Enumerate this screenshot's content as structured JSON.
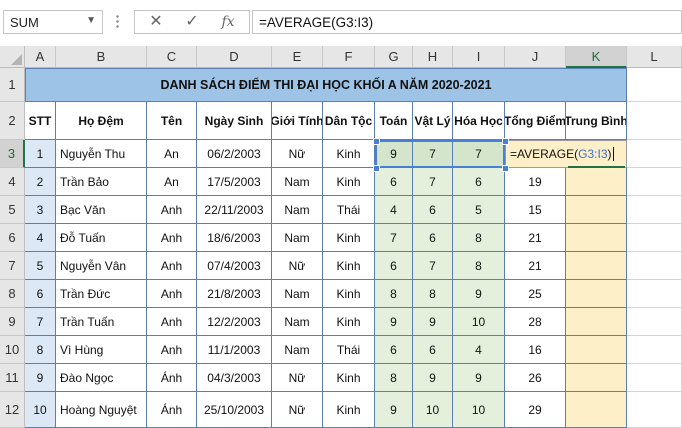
{
  "name_box": "SUM",
  "formula_buttons": {
    "cancel": "✕",
    "enter": "✓",
    "fx": "fx"
  },
  "formula": "=AVERAGE(G3:I3)",
  "columns": [
    "A",
    "B",
    "C",
    "D",
    "E",
    "F",
    "G",
    "H",
    "I",
    "J",
    "K",
    "L"
  ],
  "rows": [
    "1",
    "2",
    "3",
    "4",
    "5",
    "6",
    "7",
    "8",
    "9",
    "10",
    "11",
    "12"
  ],
  "title": "DANH SÁCH ĐIỂM THI ĐẠI HỌC KHỐI A NĂM 2020-2021",
  "headers": [
    "STT",
    "Họ Đệm",
    "Tên",
    "Ngày Sinh",
    "Giới Tính",
    "Dân Tộc",
    "Toán",
    "Vật Lý",
    "Hóa Học",
    "Tổng Điểm",
    "Trung Bình"
  ],
  "students": [
    {
      "stt": "1",
      "ho_dem": "Nguyễn Thu",
      "ten": "An",
      "ngay_sinh": "06/2/2003",
      "gioi_tinh": "Nữ",
      "dan_toc": "Kinh",
      "toan": "9",
      "vat_ly": "7",
      "hoa_hoc": "7",
      "tong_diem": ""
    },
    {
      "stt": "2",
      "ho_dem": "Trần Bảo",
      "ten": "An",
      "ngay_sinh": "17/5/2003",
      "gioi_tinh": "Nam",
      "dan_toc": "Kinh",
      "toan": "6",
      "vat_ly": "7",
      "hoa_hoc": "6",
      "tong_diem": "19"
    },
    {
      "stt": "3",
      "ho_dem": "Bạc Văn",
      "ten": "Anh",
      "ngay_sinh": "22/11/2003",
      "gioi_tinh": "Nam",
      "dan_toc": "Thái",
      "toan": "4",
      "vat_ly": "6",
      "hoa_hoc": "5",
      "tong_diem": "15"
    },
    {
      "stt": "4",
      "ho_dem": "Đỗ Tuấn",
      "ten": "Anh",
      "ngay_sinh": "18/6/2003",
      "gioi_tinh": "Nam",
      "dan_toc": "Kinh",
      "toan": "7",
      "vat_ly": "6",
      "hoa_hoc": "8",
      "tong_diem": "21"
    },
    {
      "stt": "5",
      "ho_dem": "Nguyễn Vân",
      "ten": "Anh",
      "ngay_sinh": "07/4/2003",
      "gioi_tinh": "Nữ",
      "dan_toc": "Kinh",
      "toan": "6",
      "vat_ly": "7",
      "hoa_hoc": "8",
      "tong_diem": "21"
    },
    {
      "stt": "6",
      "ho_dem": "Trần Đức",
      "ten": "Anh",
      "ngay_sinh": "21/8/2003",
      "gioi_tinh": "Nam",
      "dan_toc": "Kinh",
      "toan": "8",
      "vat_ly": "8",
      "hoa_hoc": "9",
      "tong_diem": "25"
    },
    {
      "stt": "7",
      "ho_dem": "Trần Tuấn",
      "ten": "Anh",
      "ngay_sinh": "12/2/2003",
      "gioi_tinh": "Nam",
      "dan_toc": "Kinh",
      "toan": "9",
      "vat_ly": "9",
      "hoa_hoc": "10",
      "tong_diem": "28"
    },
    {
      "stt": "8",
      "ho_dem": "Vì Hùng",
      "ten": "Anh",
      "ngay_sinh": "11/1/2003",
      "gioi_tinh": "Nam",
      "dan_toc": "Thái",
      "toan": "6",
      "vat_ly": "6",
      "hoa_hoc": "4",
      "tong_diem": "16"
    },
    {
      "stt": "9",
      "ho_dem": "Đào Ngọc",
      "ten": "Ánh",
      "ngay_sinh": "04/3/2003",
      "gioi_tinh": "Nữ",
      "dan_toc": "Kinh",
      "toan": "8",
      "vat_ly": "9",
      "hoa_hoc": "9",
      "tong_diem": "26"
    },
    {
      "stt": "10",
      "ho_dem": "Hoàng Nguyệt",
      "ten": "Ánh",
      "ngay_sinh": "25/10/2003",
      "gioi_tinh": "Nữ",
      "dan_toc": "Kinh",
      "toan": "9",
      "vat_ly": "10",
      "hoa_hoc": "10",
      "tong_diem": "29"
    }
  ],
  "editing": {
    "prefix": "=AVERAGE(",
    "ref": "G3:I3",
    "suffix": ")"
  },
  "colors": {
    "accent": "#217346",
    "title_fill": "#9dc3e6",
    "score_fill": "#e4f0dc",
    "avg_fill": "#fdf0c8",
    "stt_fill": "#dde8f6",
    "ref_border": "#4a7fd6"
  }
}
